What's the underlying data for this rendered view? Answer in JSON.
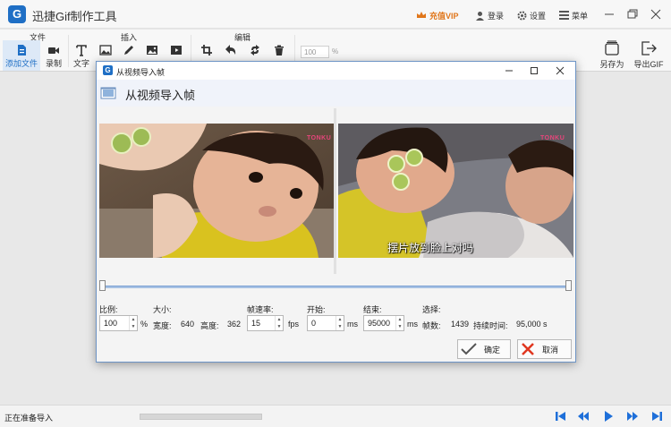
{
  "app": {
    "title": "迅捷Gif制作工具",
    "logo_letter": "G",
    "vip": "充值VIP",
    "login": "登录",
    "settings": "设置",
    "menu": "菜单"
  },
  "ribbon": {
    "groups": {
      "file": "文件",
      "insert": "插入",
      "edit": "编辑"
    },
    "buttons": {
      "add_file": "添加文件",
      "record": "录制",
      "text": "文字",
      "zoom_value": "100",
      "zoom_unit": "%",
      "save_as": "另存为",
      "export_gif": "导出GIF"
    }
  },
  "dialog": {
    "title": "从视频导入帧",
    "heading": "从视频导入帧",
    "frame_mark": "TONKU",
    "subtitle": "摆片放到脸上对吗",
    "params": {
      "scale_label": "比例:",
      "scale_value": "100",
      "scale_unit": "%",
      "size_label": "大小:",
      "width_label": "宽度:",
      "width_value": "640",
      "height_label": "高度:",
      "height_value": "362",
      "fps_label": "帧速率:",
      "fps_value": "15",
      "fps_unit": "fps",
      "start_label": "开始:",
      "start_value": "0",
      "start_unit": "ms",
      "end_label": "结束:",
      "end_value": "95000",
      "end_unit": "ms",
      "select_label": "选择:",
      "frames_label": "帧数:",
      "frames_value": "1439",
      "duration_label": "持续时间:",
      "duration_value": "95,000 s"
    },
    "ok_button": "确定",
    "cancel_button": "取消"
  },
  "status": {
    "text": "正在准备导入"
  },
  "colors": {
    "accent": "#1f6fc5",
    "vip": "#e0761a",
    "nav": "#1e6fd9",
    "ok_check": "#555555",
    "cancel_x": "#e0361f"
  }
}
